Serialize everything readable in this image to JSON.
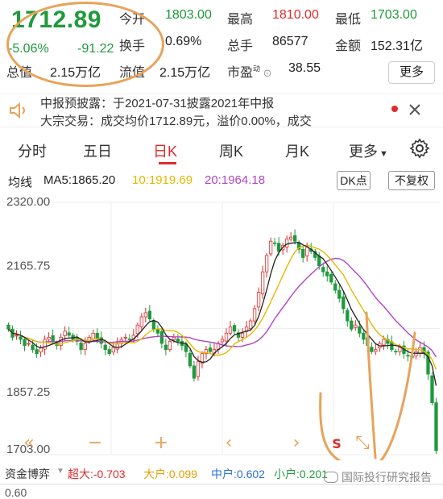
{
  "quote": {
    "price": "1712.89",
    "change_pct": "-5.06%",
    "change_abs": "-91.22",
    "stats": [
      {
        "label": "今开",
        "value": "1803.00",
        "color": "#1f9a3c"
      },
      {
        "label": "最高",
        "value": "1810.00",
        "color": "#e02b2b"
      },
      {
        "label": "最低",
        "value": "1703.00",
        "color": "#1f9a3c"
      },
      {
        "label": "换手",
        "value": "0.69%",
        "color": "#222222"
      },
      {
        "label": "总手",
        "value": "86577",
        "color": "#222222"
      },
      {
        "label": "金额",
        "value": "152.31亿",
        "color": "#222222"
      },
      {
        "label": "总值",
        "value": "2.15万亿",
        "color": "#222222"
      },
      {
        "label": "流值",
        "value": "2.15万亿",
        "color": "#222222"
      },
      {
        "label": "市盈",
        "value": "38.55",
        "color": "#222222"
      }
    ],
    "pe_superscript": "动",
    "more_label": "更多"
  },
  "notice": {
    "line1": "中报预披露：于2021-07-31披露2021年中报",
    "line2": "大宗交易：成交均价1712.89元，溢价0.00%，成交"
  },
  "tabs": [
    {
      "label": "分时"
    },
    {
      "label": "五日"
    },
    {
      "label": "日K"
    },
    {
      "label": "周K"
    },
    {
      "label": "月K"
    },
    {
      "label": "更多"
    }
  ],
  "ma": {
    "title": "均线",
    "ma5": "MA5:1865.20",
    "ma10": "10:1919.69",
    "ma20": "20:1964.18",
    "dk_label": "DK点",
    "adjust_label": "不复权"
  },
  "colors": {
    "up": "#e02b2b",
    "down": "#1f9a3c",
    "ma5": "#222222",
    "ma10": "#e6b800",
    "ma20": "#b044c4",
    "annotation": "#e8a35a"
  },
  "chart_data": {
    "type": "candlestick",
    "y_ticks": [
      "2320.00",
      "2165.75",
      "1857.25",
      "1703.00"
    ],
    "ylim": [
      1703,
      2320
    ],
    "closes": [
      2010,
      1990,
      1995,
      1985,
      1970,
      1975,
      1960,
      1950,
      1965,
      1985,
      1990,
      1980,
      1970,
      1990,
      2005,
      1995,
      1985,
      1980,
      1960,
      1975,
      1990,
      2000,
      1985,
      1975,
      1960,
      1950,
      1965,
      1975,
      1985,
      1990,
      1985,
      1995,
      2020,
      2040,
      2050,
      2035,
      2010,
      2000,
      1975,
      1960,
      1980,
      1990,
      1980,
      1970,
      1955,
      1920,
      1890,
      1930,
      1950,
      1960,
      1955,
      1960,
      1975,
      1985,
      2000,
      2015,
      2005,
      1990,
      2000,
      2015,
      2030,
      2060,
      2100,
      2150,
      2190,
      2225,
      2220,
      2200,
      2215,
      2230,
      2235,
      2225,
      2205,
      2185,
      2210,
      2200,
      2185,
      2165,
      2150,
      2140,
      2125,
      2105,
      2085,
      2060,
      2030,
      2010,
      2020,
      2000,
      1985,
      1970,
      1955,
      1960,
      1975,
      1985,
      1975,
      1960,
      1955,
      1965,
      1950,
      1945,
      1940,
      1955,
      1965,
      1950,
      1900,
      1830,
      1712.89
    ],
    "ma5_label": "MA5",
    "ma10_label": "MA10",
    "ma20_label": "MA20"
  },
  "controls": [
    "«",
    "−",
    "+",
    "‹",
    "›",
    "S",
    "⤡"
  ],
  "capital": {
    "title": "资金博弈",
    "super": "超大:-0.703",
    "big": "大户:0.099",
    "mid": "中户:0.602",
    "small": "小户:0.201"
  },
  "bottom_value": "0.60",
  "watermark": "国际投行研究报告"
}
